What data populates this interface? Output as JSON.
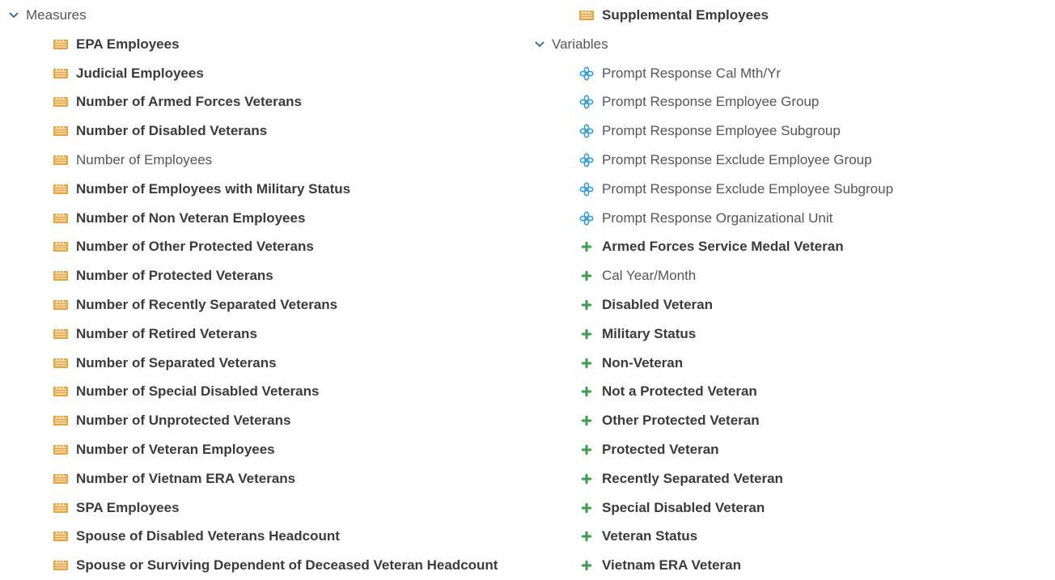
{
  "colors": {
    "measure_icon": "#e8a33a",
    "prompt_icon": "#2f9ee0",
    "variable_icon": "#3aa14a",
    "chevron": "#2a5fa8"
  },
  "measures": {
    "header": "Measures",
    "items": [
      {
        "label": "EPA Employees",
        "bold": true
      },
      {
        "label": "Judicial Employees",
        "bold": true
      },
      {
        "label": "Number of Armed Forces Veterans",
        "bold": true
      },
      {
        "label": "Number of Disabled Veterans",
        "bold": true
      },
      {
        "label": "Number of Employees",
        "bold": false
      },
      {
        "label": "Number of Employees with Military Status",
        "bold": true
      },
      {
        "label": "Number of Non Veteran Employees",
        "bold": true
      },
      {
        "label": "Number of Other Protected Veterans",
        "bold": true
      },
      {
        "label": "Number of Protected Veterans",
        "bold": true
      },
      {
        "label": "Number of Recently Separated Veterans",
        "bold": true
      },
      {
        "label": "Number of Retired Veterans",
        "bold": true
      },
      {
        "label": "Number of Separated Veterans",
        "bold": true
      },
      {
        "label": "Number of Special Disabled Veterans",
        "bold": true
      },
      {
        "label": "Number of Unprotected Veterans",
        "bold": true
      },
      {
        "label": "Number of Veteran Employees",
        "bold": true
      },
      {
        "label": "Number of Vietnam ERA Veterans",
        "bold": true
      },
      {
        "label": "SPA Employees",
        "bold": true
      },
      {
        "label": "Spouse of Disabled Veterans Headcount",
        "bold": true
      },
      {
        "label": "Spouse or Surviving Dependent of Deceased Veteran Headcount",
        "bold": true
      }
    ]
  },
  "supplemental": {
    "label": "Supplemental Employees",
    "bold": true
  },
  "variables": {
    "header": "Variables",
    "items": [
      {
        "label": "Prompt Response Cal Mth/Yr",
        "bold": false,
        "icon": "prompt"
      },
      {
        "label": "Prompt Response Employee Group",
        "bold": false,
        "icon": "prompt"
      },
      {
        "label": "Prompt Response Employee Subgroup",
        "bold": false,
        "icon": "prompt"
      },
      {
        "label": "Prompt Response Exclude Employee Group",
        "bold": false,
        "icon": "prompt"
      },
      {
        "label": "Prompt Response Exclude Employee Subgroup",
        "bold": false,
        "icon": "prompt"
      },
      {
        "label": "Prompt Response Organizational Unit",
        "bold": false,
        "icon": "prompt"
      },
      {
        "label": "Armed Forces Service Medal Veteran",
        "bold": true,
        "icon": "variable"
      },
      {
        "label": "Cal Year/Month",
        "bold": false,
        "icon": "variable"
      },
      {
        "label": "Disabled Veteran",
        "bold": true,
        "icon": "variable"
      },
      {
        "label": "Military Status",
        "bold": true,
        "icon": "variable"
      },
      {
        "label": "Non-Veteran",
        "bold": true,
        "icon": "variable"
      },
      {
        "label": "Not a Protected Veteran",
        "bold": true,
        "icon": "variable"
      },
      {
        "label": "Other Protected Veteran",
        "bold": true,
        "icon": "variable"
      },
      {
        "label": "Protected Veteran",
        "bold": true,
        "icon": "variable"
      },
      {
        "label": "Recently Separated Veteran",
        "bold": true,
        "icon": "variable"
      },
      {
        "label": "Special Disabled Veteran",
        "bold": true,
        "icon": "variable"
      },
      {
        "label": "Veteran Status",
        "bold": true,
        "icon": "variable"
      },
      {
        "label": "Vietnam ERA Veteran",
        "bold": true,
        "icon": "variable"
      }
    ]
  }
}
